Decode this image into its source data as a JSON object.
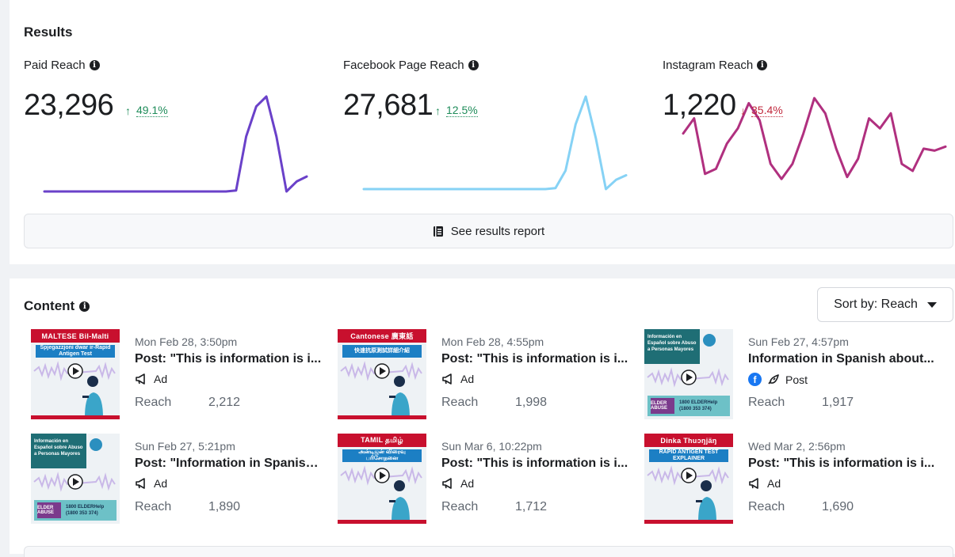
{
  "results": {
    "title": "Results",
    "metrics": [
      {
        "label": "Paid Reach",
        "value": "23,296",
        "delta": "49.1%",
        "direction": "up",
        "color": "#6a41c9",
        "trend": [
          0,
          0,
          0,
          0,
          0,
          0,
          0,
          0,
          0,
          0,
          0,
          0,
          0,
          0,
          0,
          0,
          0,
          0,
          0,
          1,
          55,
          85,
          95,
          55,
          0,
          10,
          15
        ]
      },
      {
        "label": "Facebook Page Reach",
        "value": "27,681",
        "delta": "12.5%",
        "direction": "up",
        "color": "#86d2f5",
        "trend": [
          0,
          0,
          0,
          0,
          0,
          0,
          0,
          0,
          0,
          0,
          0,
          0,
          0,
          0,
          0,
          0,
          0,
          0,
          0,
          1,
          20,
          70,
          100,
          55,
          0,
          10,
          15
        ]
      },
      {
        "label": "Instagram Reach",
        "value": "1,220",
        "delta": "35.4%",
        "direction": "down",
        "color": "#b0307f",
        "trend": [
          55,
          70,
          15,
          20,
          45,
          60,
          85,
          68,
          25,
          10,
          25,
          55,
          90,
          75,
          40,
          12,
          30,
          70,
          60,
          75,
          25,
          18,
          40,
          38,
          42
        ]
      }
    ],
    "report_button": "See results report"
  },
  "content": {
    "title": "Content",
    "sort_label": "Sort by: Reach",
    "reach_label": "Reach",
    "posts": [
      {
        "date": "Mon Feb 28, 3:50pm",
        "title": "Post: \"This is information is i...",
        "type": "Ad",
        "reach": "2,212",
        "thumb_banner": "MALTESE  Bil-Malti",
        "thumb_sub": "Spjegazzjoni dwar ir-Rapid Antigen Test"
      },
      {
        "date": "Mon Feb 28, 4:55pm",
        "title": "Post: \"This is information is i...",
        "type": "Ad",
        "reach": "1,998",
        "thumb_banner": "Cantonese  廣東話",
        "thumb_sub": "快速抗原測試詳細介紹"
      },
      {
        "date": "Sun Feb 27, 4:57pm",
        "title": "Information in Spanish about...",
        "type": "Post",
        "reach": "1,917",
        "thumb_head": "Información en Español sobre Abuso a Personas Mayores",
        "thumb_elder": "ELDER ABUSE",
        "thumb_phone": "1800 ELDERHelp (1800 353 374)"
      },
      {
        "date": "Sun Feb 27, 5:21pm",
        "title": "Post: \"Information in Spanish...",
        "type": "Ad",
        "reach": "1,890",
        "thumb_head": "Información en Español sobre Abuso a Personas Mayores",
        "thumb_elder": "ELDER ABUSE",
        "thumb_phone": "1800 ELDERHelp (1800 353 374)"
      },
      {
        "date": "Sun Mar 6, 10:22pm",
        "title": "Post: \"This is information is i...",
        "type": "Ad",
        "reach": "1,712",
        "thumb_banner": "TAMIL  தமிழ்",
        "thumb_sub": "அன்டிஜன் விரைவு பரிசோதனை"
      },
      {
        "date": "Wed Mar 2, 2:56pm",
        "title": "Post: \"This is information is i...",
        "type": "Ad",
        "reach": "1,690",
        "thumb_banner": "Dinka  Thuɔŋjäŋ",
        "thumb_sub": "RAPID ANTIGEN TEST EXPLAINER"
      }
    ]
  }
}
